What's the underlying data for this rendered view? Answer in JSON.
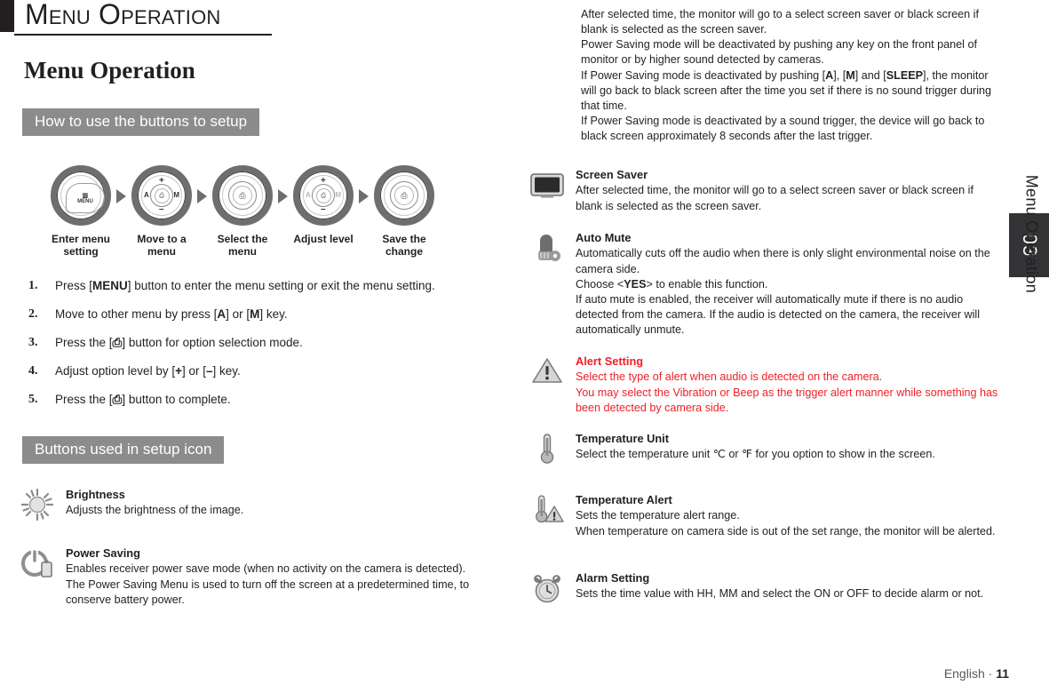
{
  "header": {
    "title": "Menu Operation"
  },
  "left": {
    "h1": "Menu Operation",
    "section_how_to": "How to use the buttons to setup",
    "section_buttons_icon": "Buttons used in setup icon",
    "flow": [
      {
        "caption": "Enter menu setting",
        "icon": "dial-menu-button-icon",
        "center_label": "MENU"
      },
      {
        "caption": "Move to a menu",
        "icon": "dial-a-m-button-icon",
        "left": "A",
        "right": "M",
        "top": "+",
        "bottom": "–"
      },
      {
        "caption": "Select the menu",
        "icon": "dial-select-button-icon"
      },
      {
        "caption": "Adjust level",
        "icon": "dial-plus-minus-button-icon",
        "left": "A",
        "right": "M",
        "top": "+",
        "bottom": "–"
      },
      {
        "caption": "Save the change",
        "icon": "dial-save-button-icon"
      }
    ],
    "steps": [
      {
        "num": "1.",
        "pre": "Press [",
        "key": "MENU",
        "post": "] button to enter the menu setting or exit the menu setting."
      },
      {
        "num": "2.",
        "pre": "Move to other menu by press [",
        "key": "A",
        "mid": "] or [",
        "key2": "M",
        "post": "] key."
      },
      {
        "num": "3.",
        "pre": "Press the [",
        "key": "⎙",
        "post": "] button for option selection mode."
      },
      {
        "num": "4.",
        "pre": "Adjust option level by [",
        "key": "+",
        "mid": "] or [",
        "key2": "–",
        "post": "] key."
      },
      {
        "num": "5.",
        "pre": "Press the [",
        "key": "⎙",
        "post": "] button to complete."
      }
    ],
    "entries": [
      {
        "icon": "brightness-sun-icon",
        "title": "Brightness",
        "lines": [
          "Adjusts the brightness of the image."
        ]
      },
      {
        "icon": "power-saving-battery-icon",
        "title": "Power Saving",
        "lines": [
          "Enables receiver power save mode (when no activity on the camera is detected).",
          "The Power Saving Menu is used to turn off the screen at a predetermined time, to conserve battery power."
        ]
      }
    ]
  },
  "right": {
    "intro": [
      "After selected time, the monitor will go to a select screen saver or black screen if blank is selected as the screen saver.",
      "Power Saving mode will be deactivated by pushing any key on the front panel of monitor or by higher sound detected by cameras.",
      "If Power Saving mode is deactivated by pushing [A], [M] and [SLEEP], the monitor will go back to black screen after the time you set if there is no sound trigger during that time.",
      "If Power Saving mode is deactivated by a sound trigger, the device will go back to black screen approximately 8 seconds after the last trigger."
    ],
    "intro_keys": [
      "A",
      "M",
      "SLEEP"
    ],
    "entries": [
      {
        "icon": "screen-saver-monitor-icon",
        "title": "Screen Saver",
        "lines": [
          "After selected time, the monitor will go to a select screen saver or black screen if blank is selected as the screen saver."
        ],
        "color": "default"
      },
      {
        "icon": "auto-mute-microphone-icon",
        "title": "Auto Mute",
        "lines": [
          "Automatically cuts off the audio when there is only slight environmental noise on the camera side.",
          "Choose <YES> to enable this function.",
          "If auto mute is enabled, the receiver will automatically mute if there is no audio detected from the camera. If the audio is detected on the camera, the receiver will automatically unmute."
        ],
        "color": "default"
      },
      {
        "icon": "alert-setting-warning-icon",
        "title": "Alert Setting",
        "lines": [
          "Select the type of alert when audio is detected on the camera.",
          "You may select the Vibration or Beep as the trigger alert manner while something has been detected by camera side."
        ],
        "color": "red"
      },
      {
        "icon": "temperature-unit-thermometer-icon",
        "title": "Temperature Unit",
        "lines": [
          "Select the temperature unit ℃ or ℉ for you option to show in the screen."
        ],
        "color": "default"
      },
      {
        "icon": "temperature-alert-thermometer-warning-icon",
        "title": "Temperature Alert",
        "lines": [
          "Sets the temperature alert range.",
          "When temperature on camera side is out of the set range, the monitor will be alerted."
        ],
        "color": "default"
      },
      {
        "icon": "alarm-setting-clock-icon",
        "title": "Alarm Setting",
        "lines": [
          "Sets the time value with HH, MM and select the ON or OFF to decide alarm or not."
        ],
        "color": "default"
      }
    ]
  },
  "sidebar": {
    "chapter_number": "03",
    "chapter_label": "Menu Operation",
    "tab_color": "#333336"
  },
  "footer": {
    "language": "English",
    "separator": "·",
    "page": "11"
  },
  "colors": {
    "accent_red": "#ee2026",
    "gray_bar": "#8c8c8c",
    "ink": "#231f20"
  }
}
